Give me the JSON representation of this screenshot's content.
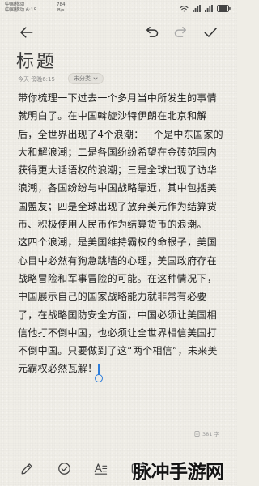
{
  "status_bar": {
    "carrier_primary": "中国移动",
    "carrier_secondary": "中国移动",
    "time": "6:15",
    "net_speed_value": "784",
    "net_speed_unit": "B/s",
    "icons": [
      "wifi-icon",
      "signal-icon",
      "signal-icon",
      "battery-icon"
    ]
  },
  "toolbar": {
    "icons": [
      "arrow-left-icon",
      "undo-icon",
      "redo-icon",
      "check-icon"
    ]
  },
  "note": {
    "title": "标题",
    "timestamp": "今天 傍晚6:15",
    "category": "未分类",
    "body_lines": [
      "带你梳理一下过去一个多月当中所发生的事情",
      "就明白了。在中国斡旋沙特伊朗在北京和解",
      "后，全世界出现了4个浪潮：一个是中东国家的",
      "大和解浪潮；二是各国纷纷希望在金砖范围内",
      "获得更大话语权的浪潮；三是全球出现了访华",
      "浪潮，各国纷纷与中国战略靠近，其中包括美",
      "国盟友；四是全球出现了放弃美元作为结算货",
      "币、积极使用人民币作为结算货币的浪潮。",
      "这四个浪潮，是美国维持霸权的命根子，美国",
      "心目中必然有狗急跳墙的心理，美国政府存在",
      "战略冒险和军事冒险的可能。在这种情况下，",
      "中国展示自己的国家战略能力就非常有必要",
      "了，在战略国防安全方面，中国必须让美国相",
      "信他打不倒中国，也必须让全世界相信美国打",
      "不倒中国。只要做到了这“两个相信”，未来美",
      "元霸权必然瓦解！"
    ],
    "word_count": "381 字"
  },
  "bottom_bar": {
    "icons": [
      "pen-icon",
      "check-circle-icon",
      "text-format-icon",
      "image-icon"
    ]
  },
  "watermark": "脉冲手游网",
  "colors": {
    "paper": "#efede6",
    "text": "#1f1f1f",
    "icon": "#333333",
    "disabled_icon": "#a8a8a8",
    "cursor": "#2d7ddb",
    "meta_text": "#8a8a8a"
  }
}
